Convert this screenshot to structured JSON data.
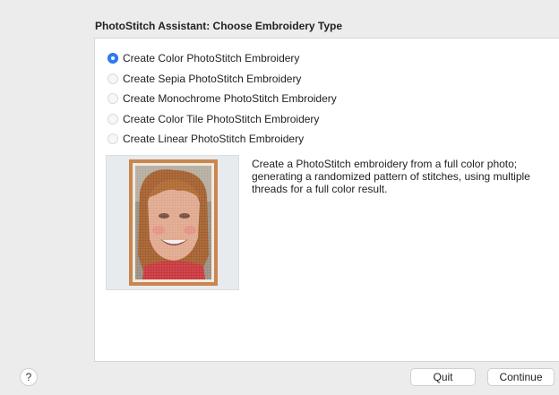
{
  "dialog": {
    "title": "PhotoStitch Assistant: Choose Embroidery Type"
  },
  "options": [
    {
      "label": "Create Color PhotoStitch Embroidery",
      "selected": true
    },
    {
      "label": "Create Sepia PhotoStitch Embroidery",
      "selected": false
    },
    {
      "label": "Create Monochrome PhotoStitch Embroidery",
      "selected": false
    },
    {
      "label": "Create Color Tile PhotoStitch Embroidery",
      "selected": false
    },
    {
      "label": "Create Linear PhotoStitch Embroidery",
      "selected": false
    }
  ],
  "description": "Create a PhotoStitch embroidery from a full color photo; generating a randomized pattern of stitches, using multiple threads for a full color result.",
  "footer": {
    "help_label": "?",
    "quit_label": "Quit",
    "continue_label": "Continue"
  },
  "colors": {
    "accent": "#2f7cf6",
    "frame": "#c9864e"
  }
}
